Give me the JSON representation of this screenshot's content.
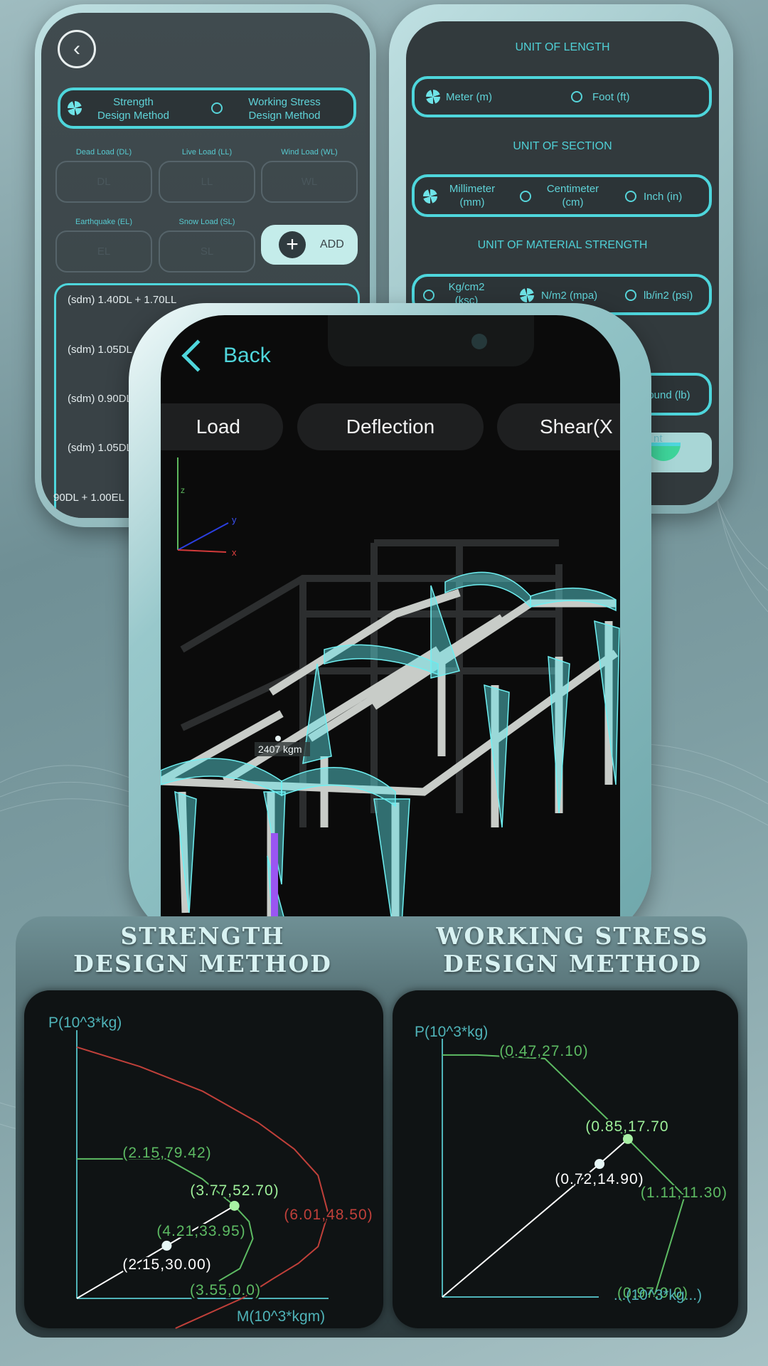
{
  "load_screen": {
    "method_options": [
      {
        "label_line1": "Strength",
        "label_line2": "Design Method",
        "selected": true
      },
      {
        "label_line1": "Working Stress",
        "label_line2": "Design Method",
        "selected": false
      }
    ],
    "load_fields": [
      {
        "label": "Dead Load (DL)",
        "placeholder": "DL"
      },
      {
        "label": "Live Load (LL)",
        "placeholder": "LL"
      },
      {
        "label": "Wind Load (WL)",
        "placeholder": "WL"
      },
      {
        "label": "Earthquake (EL)",
        "placeholder": "EL"
      },
      {
        "label": "Snow Load (SL)",
        "placeholder": "SL"
      }
    ],
    "add_label": "ADD",
    "combinations": [
      "(sdm) 1.40DL + 1.70LL",
      "(sdm) 1.05DL",
      "(sdm) 0.90DL",
      "(sdm) 1.05DL",
      "90DL + 1.00EL"
    ]
  },
  "units_screen": {
    "length_title": "UNIT OF LENGTH",
    "length_options": [
      {
        "label": "Meter (m)",
        "selected": true
      },
      {
        "label": "Foot (ft)",
        "selected": false
      }
    ],
    "section_title": "UNIT OF SECTION",
    "section_options": [
      {
        "label": "Millimeter (mm)",
        "selected": true
      },
      {
        "label": "Centimeter (cm)",
        "selected": false
      },
      {
        "label": "Inch (in)",
        "selected": false
      }
    ],
    "material_title": "UNIT OF MATERIAL STRENGTH",
    "material_options": [
      {
        "label": "Kg/cm2 (ksc)",
        "selected": false
      },
      {
        "label": "N/m2 (mpa)",
        "selected": true
      },
      {
        "label": "lb/in2 (psi)",
        "selected": false
      }
    ],
    "force_partial": "pound (lb)",
    "button_partial": "nt"
  },
  "model_screen": {
    "back_label": "Back",
    "tabs": [
      "Load",
      "Deflection",
      "Shear(X"
    ],
    "axes": {
      "x": "x",
      "y": "y",
      "z": "z"
    },
    "moment_label": "2407 kgm"
  },
  "headings": {
    "left_line1": "STRENGTH",
    "left_line2": "DESIGN METHOD",
    "right_line1": "WORKING STRESS",
    "right_line2": "DESIGN METHOD"
  },
  "colors": {
    "accent": "#4ed6dc",
    "capacity": "#c0403a",
    "design": "#5dbb63",
    "design_light": "#9ef09a",
    "axis": "#4fb3b8"
  },
  "chart_data": [
    {
      "type": "line",
      "title": "STRENGTH DESIGN METHOD",
      "ylabel": "P(10^3*kg)",
      "xlabel": "M(10^3*kgm)",
      "series": [
        {
          "color": "#c0403a",
          "points": [
            [
              0,
              143
            ],
            [
              1.5,
              132
            ],
            [
              3,
              118
            ],
            [
              4.34,
              100
            ],
            [
              5.2,
              85
            ],
            [
              5.77,
              70
            ],
            [
              6.01,
              48.5
            ],
            [
              5.77,
              29.5
            ],
            [
              5.3,
              20
            ],
            [
              4.68,
              11
            ],
            [
              3.95,
              0
            ],
            [
              2.36,
              -17
            ]
          ]
        },
        {
          "color": "#5dbb63",
          "points": [
            [
              0,
              79.42
            ],
            [
              2.15,
              79.42
            ],
            [
              3.0,
              68
            ],
            [
              3.77,
              52.7
            ],
            [
              4.12,
              43.7
            ],
            [
              4.21,
              33.95
            ],
            [
              3.9,
              17
            ],
            [
              3.4,
              10
            ]
          ]
        },
        {
          "color": "#ffffff",
          "points": [
            [
              0,
              0
            ],
            [
              2.15,
              30
            ],
            [
              3.77,
              52.7
            ]
          ]
        }
      ],
      "labels": [
        {
          "text": "(2.15,79.42)",
          "color": "#5dbb63"
        },
        {
          "text": "(3.77,52.70)",
          "color": "#9ef09a"
        },
        {
          "text": "(6.01,48.50)",
          "color": "#c0403a"
        },
        {
          "text": "(4.21,33.95)",
          "color": "#5dbb63"
        },
        {
          "text": "(2.15,30.00)",
          "color": "#ffffff"
        },
        {
          "text": "(3.55,0.0)",
          "color": "#5dbb63"
        }
      ],
      "markers": [
        [
          2.15,
          30,
          "#e6f6f6"
        ],
        [
          3.77,
          52.7,
          "#a8f0a4"
        ]
      ]
    },
    {
      "type": "line",
      "title": "WORKING STRESS DESIGN METHOD",
      "ylabel": "P(10^3*kg)",
      "xlabel": "...(10^3*kg...)",
      "series": [
        {
          "color": "#5dbb63",
          "points": [
            [
              0,
              27.1
            ],
            [
              0.16,
              27.1
            ],
            [
              0.47,
              26.7
            ],
            [
              0.85,
              17.7
            ],
            [
              1.11,
              11.3
            ],
            [
              0.97,
              0
            ]
          ]
        },
        {
          "color": "#ffffff",
          "points": [
            [
              0,
              0
            ],
            [
              0.72,
              14.9
            ],
            [
              0.85,
              17.7
            ]
          ]
        }
      ],
      "labels": [
        {
          "text": "(0.47,27.10)",
          "color": "#5dbb63"
        },
        {
          "text": "(0.85,17.70",
          "color": "#9ef09a"
        },
        {
          "text": "(0.72,14.90)",
          "color": "#ffffff"
        },
        {
          "text": "(1.11,11.30)",
          "color": "#5dbb63"
        },
        {
          "text": "(0.97,0.0)",
          "color": "#5dbb63"
        }
      ],
      "markers": [
        [
          0.72,
          14.9,
          "#e6f6f6"
        ],
        [
          0.85,
          17.7,
          "#a8f0a4"
        ]
      ]
    }
  ]
}
